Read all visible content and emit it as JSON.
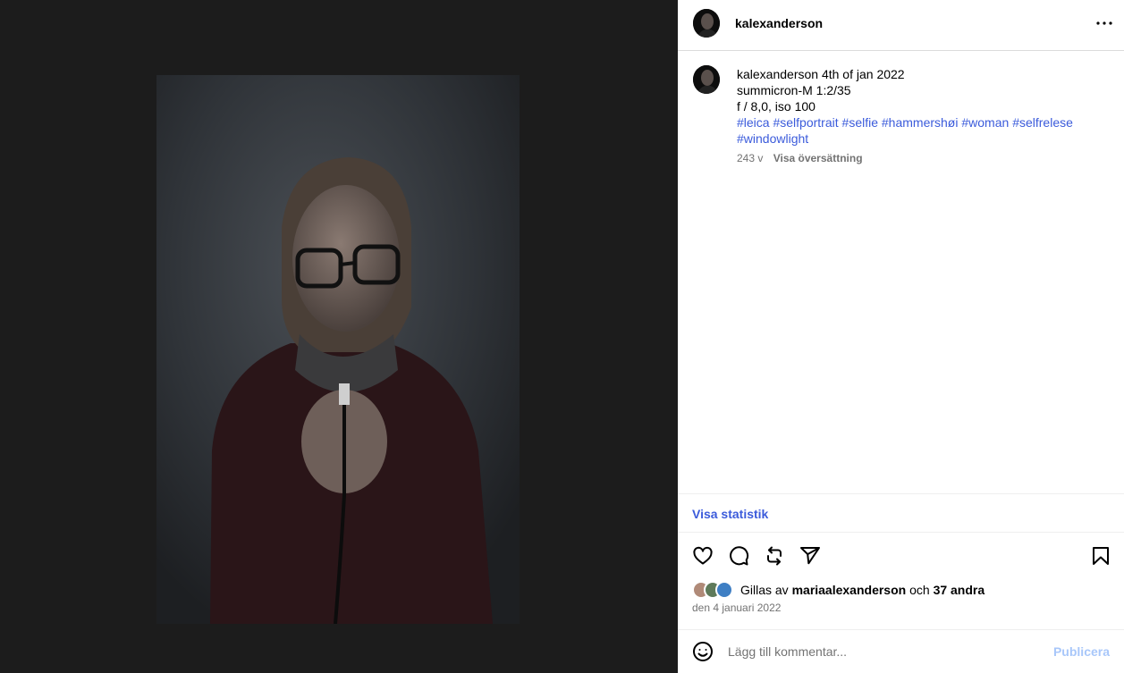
{
  "post": {
    "username": "kalexanderson",
    "image_alt": "Self portrait of a woman with glasses holding a shutter release cable"
  },
  "caption": {
    "username": "kalexanderson",
    "line1": "4th of jan 2022",
    "line2": "summicron-M 1:2/35",
    "line3": "f / 8,0, iso 100",
    "hashtags": [
      "#leica",
      "#selfportrait",
      "#selfie",
      "#hammershøi",
      "#woman",
      "#selfrelese",
      "#windowlight"
    ],
    "age": "243 v",
    "translate_label": "Visa översättning"
  },
  "stats_link": "Visa statistik",
  "actions": {
    "like_icon": "heart-icon",
    "comment_icon": "comment-icon",
    "repost_icon": "repost-icon",
    "share_icon": "send-icon",
    "save_icon": "bookmark-icon"
  },
  "likes": {
    "prefix": "Gillas av",
    "user": "mariaalexanderson",
    "joiner": "och",
    "others": "37 andra"
  },
  "date": "den 4 januari 2022",
  "comment": {
    "placeholder": "Lägg till kommentar...",
    "publish_label": "Publicera"
  },
  "colors": {
    "link": "#3b5bdb",
    "publish_disabled": "#a8c7fa",
    "muted": "#737373"
  }
}
